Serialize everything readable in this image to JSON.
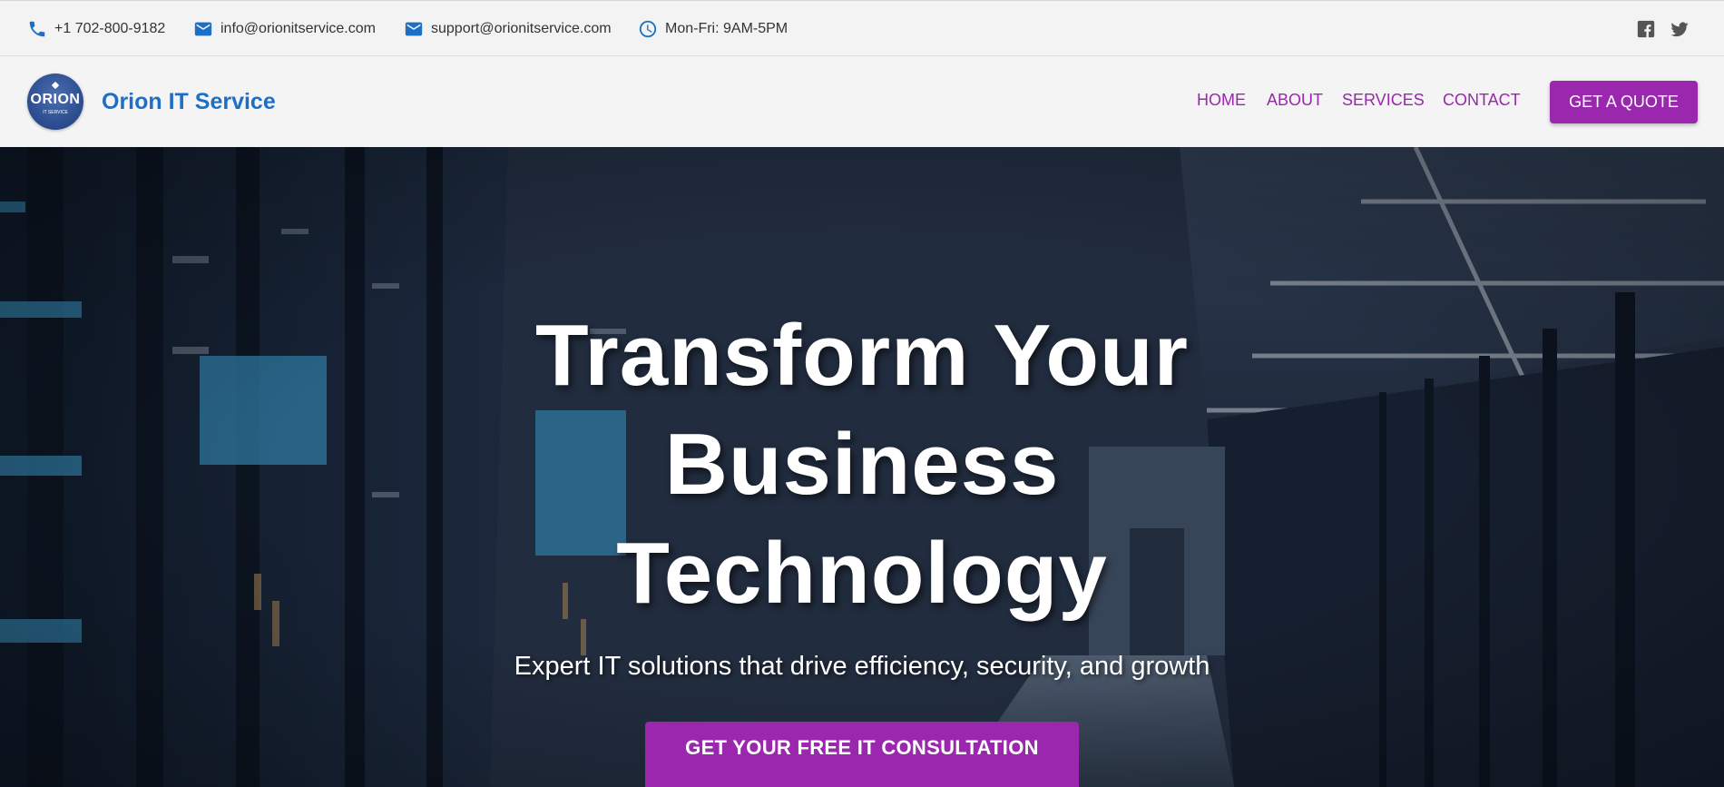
{
  "topbar": {
    "phone": "+1 702-800-9182",
    "email_info": "info@orionitservice.com",
    "email_support": "support@orionitservice.com",
    "hours": "Mon-Fri: 9AM-5PM",
    "icons": [
      "phone-icon",
      "mail-icon",
      "mail-icon",
      "clock-icon",
      "facebook-icon",
      "twitter-icon"
    ]
  },
  "header": {
    "logo_text": "ORION",
    "logo_subtext": "IT SERVICE",
    "brand": "Orion IT Service",
    "nav": {
      "home": "HOME",
      "about": "ABOUT",
      "services": "SERVICES",
      "contact": "CONTACT"
    },
    "quote_button": "GET A QUOTE"
  },
  "hero": {
    "title": "Transform Your Business Technology",
    "subtitle": "Expert IT solutions that drive efficiency, security, and growth",
    "cta": "GET YOUR FREE IT CONSULTATION"
  },
  "colors": {
    "accent_purple": "#9b27af",
    "brand_blue": "#1c6fc7",
    "topbar_bg": "#f3f3f3"
  }
}
